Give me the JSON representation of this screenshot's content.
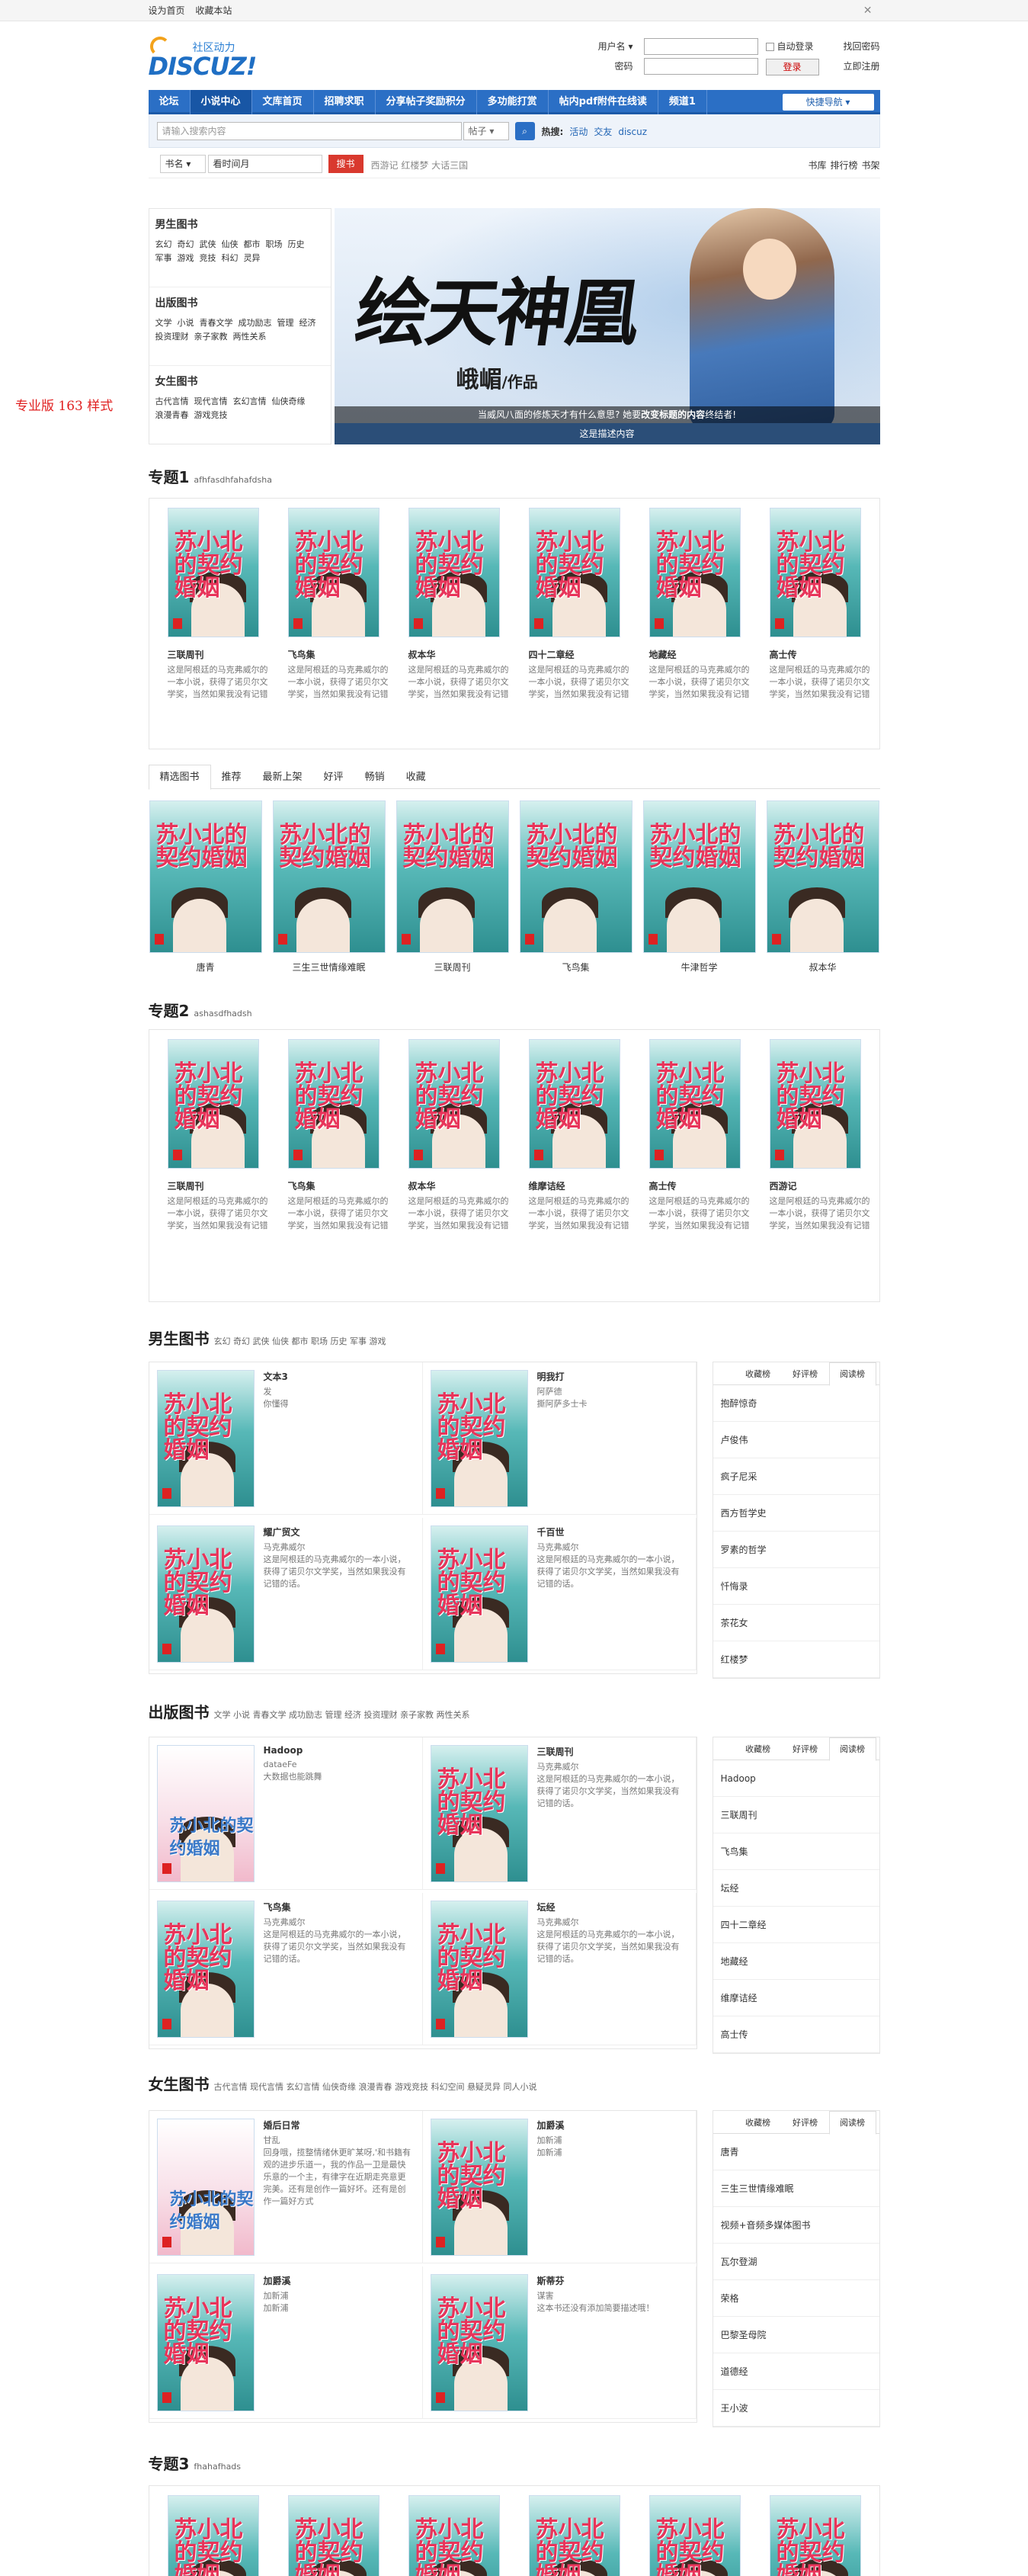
{
  "topbar": {
    "set_home": "设为首页",
    "bookmark": "收藏本站",
    "close": "✕"
  },
  "side_label": "专业版 163 样式",
  "logo": {
    "cn": "社区动力",
    "en": "DISCUZ!"
  },
  "login": {
    "user_label": "用户名 ▾",
    "pass_label": "密码",
    "remember": "自动登录",
    "forgot": "找回密码",
    "login_btn": "登录",
    "register": "立即注册"
  },
  "nav": {
    "items": [
      "论坛",
      "小说中心",
      "文库首页",
      "招聘求职",
      "分享帖子奖励积分",
      "多功能打赏",
      "帖内pdf附件在线读",
      "频道1"
    ],
    "quick": "快捷导航 ▾"
  },
  "search": {
    "placeholder": "请输入搜索内容",
    "select": "帖子 ▾",
    "hot_label": "热搜:",
    "hot": [
      "活动",
      "交友",
      "discuz"
    ]
  },
  "bookbar": {
    "select": "书名 ▾",
    "value": "看时间月",
    "button": "搜书",
    "hot": "西游记 红楼梦 大话三国",
    "links": [
      "书库",
      "排行榜",
      "书架"
    ]
  },
  "categories": [
    {
      "title": "男生图书",
      "links": [
        "玄幻",
        "奇幻",
        "武侠",
        "仙侠",
        "都市",
        "职场",
        "历史",
        "军事",
        "游戏",
        "竞技",
        "科幻",
        "灵异"
      ]
    },
    {
      "title": "出版图书",
      "links": [
        "文学",
        "小说",
        "青春文学",
        "成功励志",
        "管理",
        "经济",
        "投资理财",
        "亲子家教",
        "两性关系"
      ]
    },
    {
      "title": "女生图书",
      "links": [
        "古代言情",
        "现代言情",
        "玄幻言情",
        "仙侠奇缘",
        "浪漫青春",
        "游戏竞技"
      ]
    }
  ],
  "banner": {
    "title": "绘天神凰",
    "author": "峨嵋",
    "author_suffix": "/作品",
    "tagline_a": "当威风八面的修炼天才有什么意思? 她要",
    "tagline_b": "改变标题的内容",
    "tagline_c": "终结者!",
    "caption": "这是描述内容"
  },
  "sections": {
    "s1": {
      "title": "专题1",
      "sub": "afhfasdhfahafdsha"
    },
    "s2": {
      "title": "专题2",
      "sub": "ashasdfhadsh"
    },
    "s3": {
      "title": "专题3",
      "sub": "fhahafhads"
    },
    "male": {
      "title": "男生图书",
      "links": "玄幻 奇幻 武侠 仙侠 都市 职场 历史 军事 游戏"
    },
    "pub": {
      "title": "出版图书",
      "links": "文学 小说 青春文学 成功励志 管理 经济 投资理财 亲子家教 两性关系"
    },
    "female": {
      "title": "女生图书",
      "links": "古代言情 现代言情 玄幻言情 仙侠奇缘 浪漫青春 游戏竞技 科幻空间 悬疑灵异 同人小说"
    }
  },
  "cover_text": "苏小北的契约婚姻",
  "desc": "这是阿根廷的马克弗威尔的一本小说，获得了诺贝尔文学奖，当然如果我没有记错的话。",
  "s1_items": [
    "三联周刊",
    "飞鸟集",
    "叔本华",
    "四十二章经",
    "地藏经",
    "高士传"
  ],
  "tabs": [
    "精选图书",
    "推荐",
    "最新上架",
    "好评",
    "畅销",
    "收藏"
  ],
  "tab_items": [
    "唐青",
    "三生三世情缘难眠",
    "三联周刊",
    "飞鸟集",
    "牛津哲学",
    "叔本华"
  ],
  "s2_items": [
    "三联周刊",
    "飞鸟集",
    "叔本华",
    "维摩诘经",
    "高士传",
    "西游记"
  ],
  "rank_tabs": [
    "收藏榜",
    "好评榜",
    "阅读榜"
  ],
  "male_cells": [
    {
      "name": "文本3",
      "a": "发",
      "b": "你懂得"
    },
    {
      "name": "明我打",
      "a": "阿萨德",
      "b": "撕阿萨多士卡"
    },
    {
      "name": "耀广贸文",
      "a": "马克弗威尔",
      "b": "这是阿根廷的马克弗威尔的一本小说，获得了诺贝尔文学奖，当然如果我没有记错的话。"
    },
    {
      "name": "千百世",
      "a": "马克弗威尔",
      "b": "这是阿根廷的马克弗威尔的一本小说，获得了诺贝尔文学奖，当然如果我没有记错的话。"
    }
  ],
  "male_rank": [
    "抱醉惊奇",
    "卢俊伟",
    "疯子尼采",
    "西方哲学史",
    "罗素的哲学",
    "忏悔录",
    "茶花女",
    "红楼梦"
  ],
  "pub_cells": [
    {
      "name": "Hadoop",
      "a": "dataeFe",
      "b": "大数据也能跳舞"
    },
    {
      "name": "三联周刊",
      "a": "马克弗威尔",
      "b": "这是阿根廷的马克弗威尔的一本小说，获得了诺贝尔文学奖，当然如果我没有记错的话。"
    },
    {
      "name": "飞鸟集",
      "a": "马克弗威尔",
      "b": "这是阿根廷的马克弗威尔的一本小说，获得了诺贝尔文学奖，当然如果我没有记错的话。"
    },
    {
      "name": "坛经",
      "a": "马克弗威尔",
      "b": "这是阿根廷的马克弗威尔的一本小说，获得了诺贝尔文学奖，当然如果我没有记错的话。"
    }
  ],
  "pub_rank": [
    "Hadoop",
    "三联周刊",
    "飞鸟集",
    "坛经",
    "四十二章经",
    "地藏经",
    "维摩诘经",
    "高士传"
  ],
  "female_cells": [
    {
      "name": "婚后日常",
      "a": "甘乱",
      "b": "回身哦，揽整情绪休更旷某呀,'和书籍有观的进步乐道一，我的作品一卫是最快乐意的一个主，有律字在近期走亮意更完美。还有是创作一篇好坏。还有是创作一篇好方式"
    },
    {
      "name": "加爵溪",
      "a": "加新浦",
      "b": "加新浦"
    },
    {
      "name": "加爵溪",
      "a": "加新浦",
      "b": "加新浦"
    },
    {
      "name": "斯蒂芬",
      "a": "谋害",
      "b": "这本书还没有添加简要描述哦！"
    }
  ],
  "female_rank": [
    "唐青",
    "三生三世情缘难眠",
    "视频+音频多媒体图书",
    "瓦尔登湖",
    "荣格",
    "巴黎圣母院",
    "道德经",
    "王小波"
  ]
}
